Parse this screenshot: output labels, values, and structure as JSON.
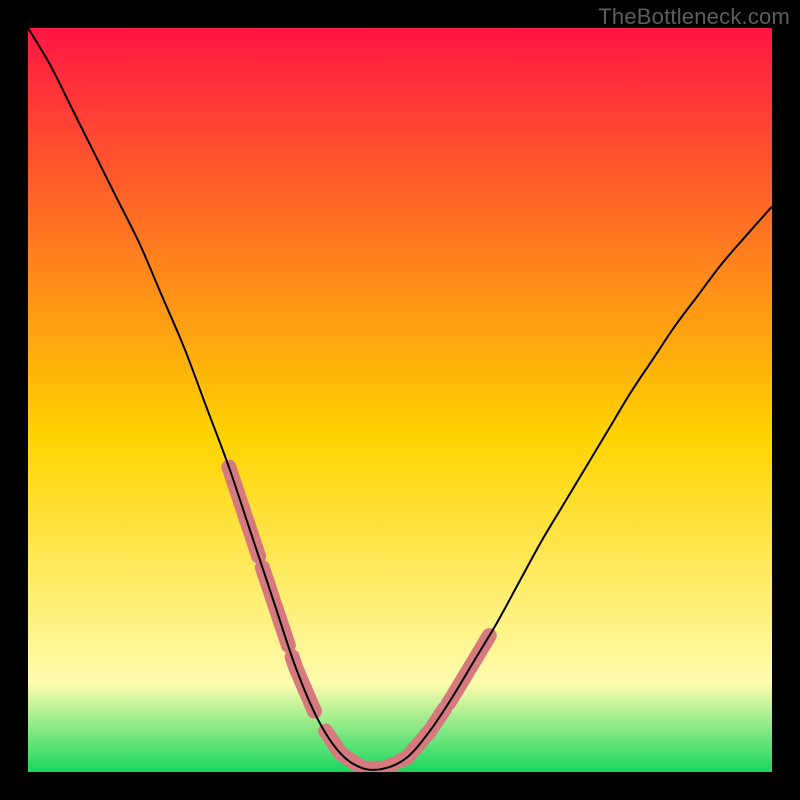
{
  "watermark": "TheBottleneck.com",
  "colors": {
    "gradient_top": "#ff1643",
    "gradient_mid": "#ffd400",
    "gradient_low": "#fffcae",
    "gradient_bottom": "#17d75f",
    "curve": "#000000",
    "highlight": "#d77a7f",
    "frame_bg": "#000000"
  },
  "chart_data": {
    "type": "line",
    "title": "",
    "xlabel": "",
    "ylabel": "",
    "xlim": [
      0,
      100
    ],
    "ylim": [
      0,
      100
    ],
    "grid": false,
    "legend": false,
    "x": [
      0,
      3,
      6,
      9,
      12,
      15,
      18,
      21,
      24,
      27,
      30,
      33,
      36,
      39,
      42,
      45,
      48,
      51,
      54,
      57,
      60,
      63,
      66,
      69,
      72,
      75,
      78,
      81,
      84,
      87,
      90,
      93,
      96,
      100
    ],
    "values": [
      100,
      95,
      89,
      83,
      77,
      71,
      64,
      57,
      49,
      41,
      32,
      23,
      14,
      7,
      2.5,
      0.5,
      0.5,
      2,
      5.5,
      10,
      15,
      20,
      25.5,
      31,
      36,
      41,
      46,
      51,
      55.5,
      60,
      64,
      68,
      71.5,
      76
    ],
    "series": [
      {
        "name": "bottleneck-curve",
        "color": "#000000"
      }
    ],
    "highlight_segments": [
      {
        "x_range": [
          27,
          31
        ],
        "note": "left-upper-pink-dash"
      },
      {
        "x_range": [
          31.5,
          35
        ],
        "note": "left-mid-pink-dash"
      },
      {
        "x_range": [
          35.5,
          38.5
        ],
        "note": "left-low-pink-dash"
      },
      {
        "x_range": [
          40,
          49
        ],
        "note": "valley-pink"
      },
      {
        "x_range": [
          50,
          56
        ],
        "note": "right-low-pink-dash"
      },
      {
        "x_range": [
          56.5,
          62
        ],
        "note": "right-upper-pink-dash"
      }
    ],
    "annotations": []
  },
  "plot_geometry": {
    "inner_left": 28,
    "inner_top": 28,
    "inner_width": 744,
    "inner_height": 744
  }
}
